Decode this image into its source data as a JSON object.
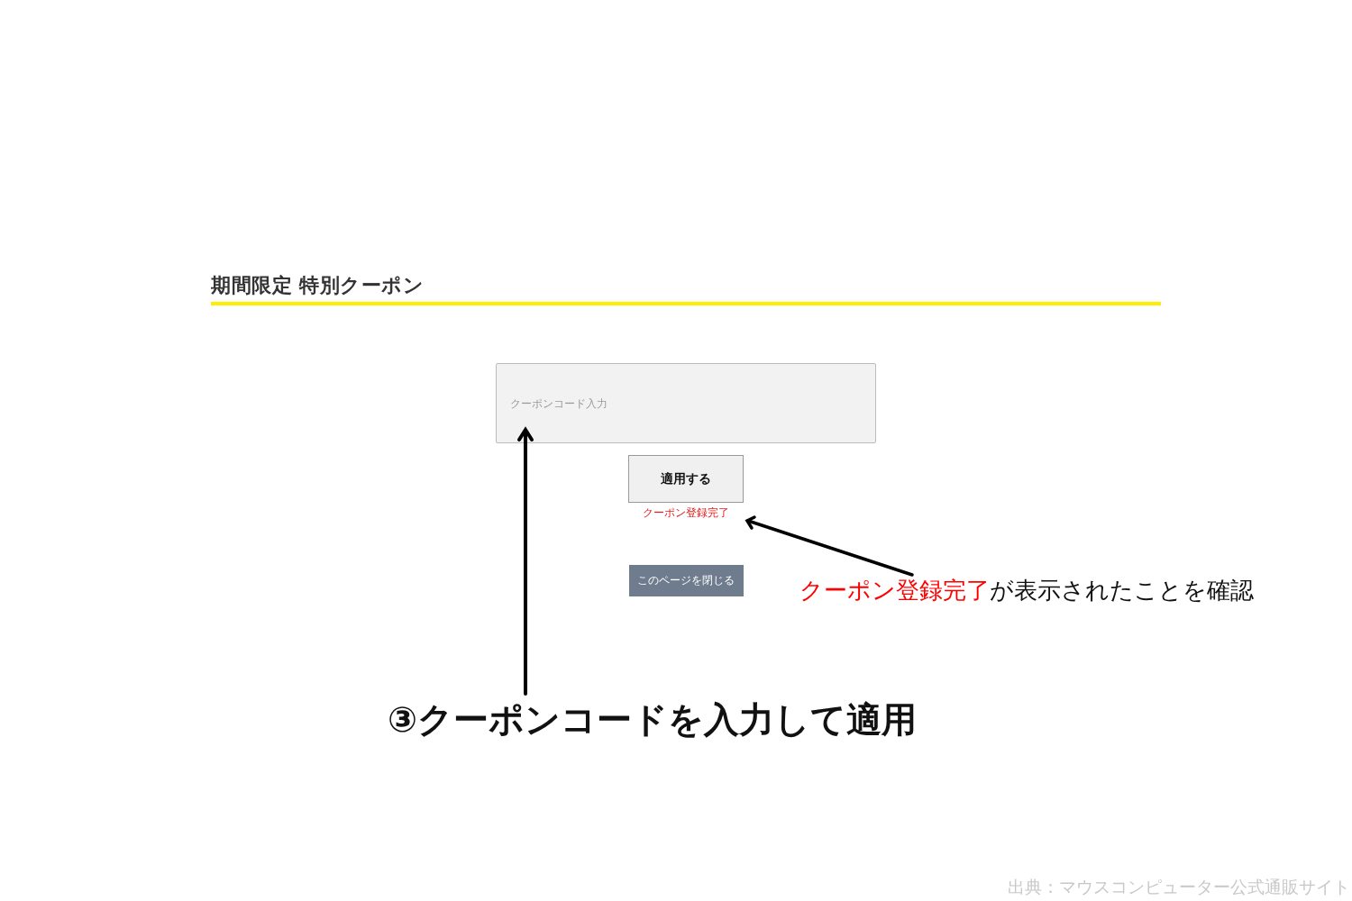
{
  "section": {
    "title": "期間限定 特別クーポン"
  },
  "coupon_field": {
    "placeholder": "クーポンコード入力"
  },
  "apply_button": {
    "label": "適用する"
  },
  "status_message": "クーポン登録完了",
  "close_button": {
    "label": "このページを閉じる"
  },
  "annotations": {
    "callout": {
      "highlight": "クーポン登録完了",
      "rest": "が表示されたことを確認"
    },
    "step_caption": "③クーポンコードを入力して適用",
    "source_credit": "出典：マウスコンピューター公式通販サイト"
  }
}
